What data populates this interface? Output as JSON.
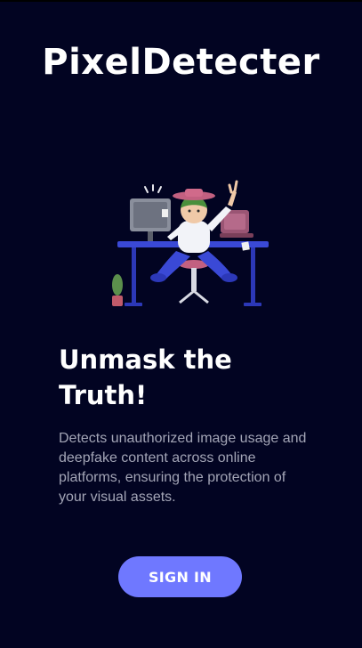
{
  "app": {
    "title": "PixelDetecter"
  },
  "hero": {
    "illustration": "person-at-desk-illustration",
    "headline": "Unmask the Truth!",
    "description": "Detects unauthorized image usage and deepfake content across online platforms, ensuring the protection of your visual assets."
  },
  "actions": {
    "signin_label": "SIGN IN"
  },
  "colors": {
    "background": "#020422",
    "accent": "#6f78ff",
    "text_primary": "#ffffff",
    "text_secondary": "#a3a5b6"
  }
}
